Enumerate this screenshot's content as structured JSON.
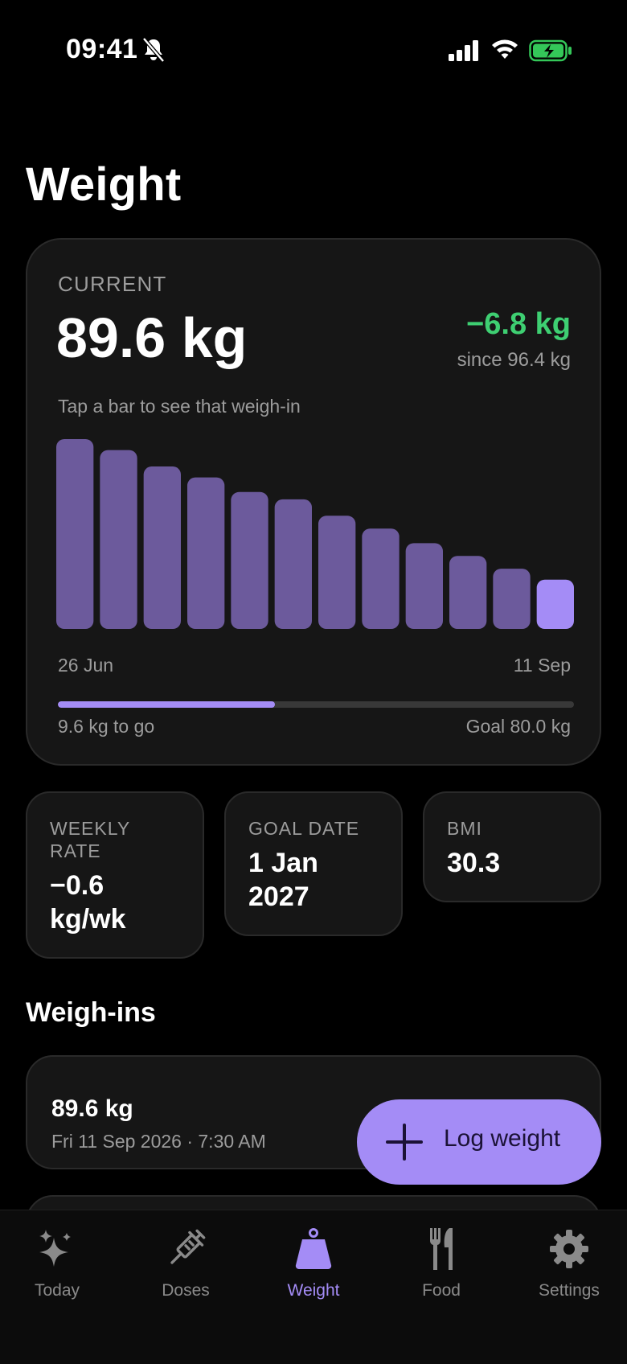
{
  "status_bar": {
    "time": "09:41",
    "silent": true,
    "battery_charging": true,
    "battery_color": "#34c759"
  },
  "page": {
    "title": "Weight"
  },
  "current_card": {
    "label": "CURRENT",
    "value": "89.6 kg",
    "delta": "−6.8 kg",
    "delta_color": "#3ecf72",
    "since": "since 96.4 kg",
    "hint": "Tap a bar to see that weigh-in",
    "date_start": "26 Jun",
    "date_end": "11 Sep",
    "progress_fraction": 0.42,
    "to_go": "9.6 kg to go",
    "goal": "Goal 80.0 kg"
  },
  "chart_data": {
    "type": "bar",
    "x": [
      "26 Jun",
      "",
      "",
      "",
      "",
      "",
      "",
      "",
      "",
      "",
      "",
      "11 Sep"
    ],
    "values": [
      96.4,
      95.8,
      94.9,
      94.3,
      93.5,
      93.1,
      92.2,
      91.5,
      90.7,
      90.0,
      89.3,
      88.7
    ],
    "highlighted_index": 11,
    "bar_color": "#6c5a9c",
    "highlight_color": "#a48cf6",
    "ylim": [
      86,
      96.4
    ],
    "title": "",
    "xlabel": "",
    "ylabel": ""
  },
  "stats": [
    {
      "label": "WEEKLY RATE",
      "value": "−0.6 kg/wk"
    },
    {
      "label": "GOAL DATE",
      "value": "1 Jan 2027"
    },
    {
      "label": "BMI",
      "value": "30.3"
    }
  ],
  "weighins": {
    "title": "Weigh-ins",
    "items": [
      {
        "weight": "89.6 kg",
        "date": "Fri 11 Sep 2026 · 7:30 AM"
      }
    ]
  },
  "fab": {
    "label": "Log weight",
    "icon": "plus-icon"
  },
  "tabs": [
    {
      "label": "Today",
      "icon": "sparkles-icon",
      "active": false
    },
    {
      "label": "Doses",
      "icon": "syringe-icon",
      "active": false
    },
    {
      "label": "Weight",
      "icon": "weight-icon",
      "active": true
    },
    {
      "label": "Food",
      "icon": "fork-knife-icon",
      "active": false
    },
    {
      "label": "Settings",
      "icon": "gear-icon",
      "active": false
    }
  ],
  "colors": {
    "accent": "#a48cf6",
    "card_bg": "#161616",
    "muted_text": "#9c9c9c"
  }
}
